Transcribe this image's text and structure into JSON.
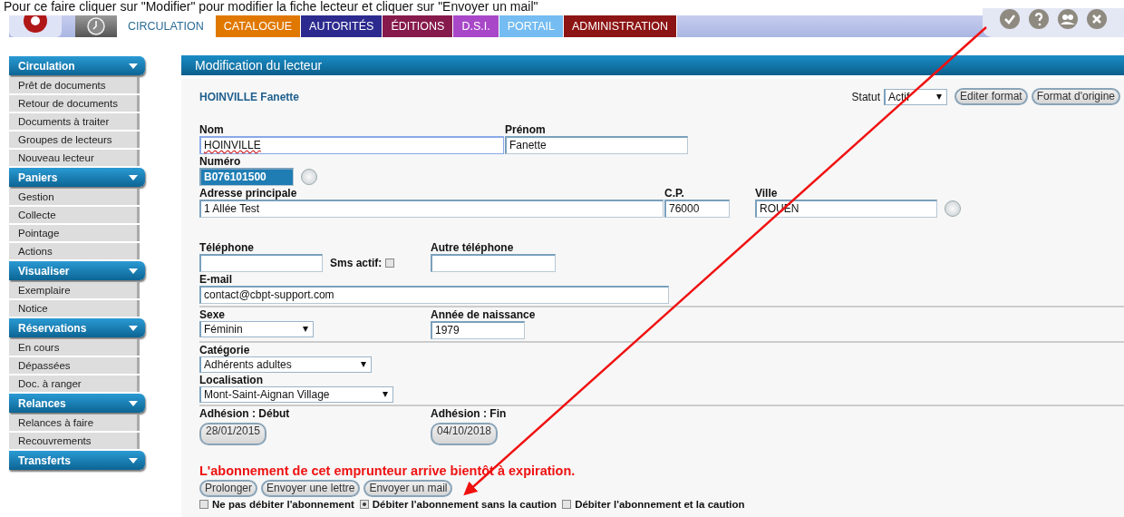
{
  "instruction": "Pour ce faire cliquer sur \"Modifier\" pour modifier la fiche lecteur et cliquer sur \"Envoyer un mail\"",
  "top_tabs": [
    {
      "label": "CIRCULATION",
      "selected": true,
      "color": "#ffffff"
    },
    {
      "label": "CATALOGUE",
      "selected": false,
      "color": "#e07800"
    },
    {
      "label": "AUTORITÉS",
      "selected": false,
      "color": "#2c2a8e"
    },
    {
      "label": "ÉDITIONS",
      "selected": false,
      "color": "#861a4c"
    },
    {
      "label": "D.S.I.",
      "selected": false,
      "color": "#a848c8"
    },
    {
      "label": "PORTAIL",
      "selected": false,
      "color": "#74bcf2"
    },
    {
      "label": "ADMINISTRATION",
      "selected": false,
      "color": "#8c1414"
    }
  ],
  "sidebar": [
    {
      "title": "Circulation",
      "items": [
        "Prêt de documents",
        "Retour de documents",
        "Documents à traiter",
        "Groupes de lecteurs",
        "Nouveau lecteur"
      ]
    },
    {
      "title": "Paniers",
      "items": [
        "Gestion",
        "Collecte",
        "Pointage",
        "Actions"
      ]
    },
    {
      "title": "Visualiser",
      "items": [
        "Exemplaire",
        "Notice"
      ]
    },
    {
      "title": "Réservations",
      "items": [
        "En cours",
        "Dépassées",
        "Doc. à ranger"
      ]
    },
    {
      "title": "Relances",
      "items": [
        "Relances à faire",
        "Recouvrements"
      ]
    },
    {
      "title": "Transferts"
    }
  ],
  "panel_title": "Modification du lecteur",
  "reader_name": "HOINVILLE Fanette",
  "statut": {
    "label": "Statut",
    "value": "Actif"
  },
  "format_buttons": [
    "Editer format",
    "Format d'origine"
  ],
  "form": {
    "nom": {
      "label": "Nom",
      "value": "HOINVILLE"
    },
    "prenom": {
      "label": "Prénom",
      "value": "Fanette"
    },
    "numero": {
      "label": "Numéro",
      "value": "B076101500"
    },
    "adresse": {
      "label": "Adresse principale",
      "value": "1 Allée Test"
    },
    "cp": {
      "label": "C.P.",
      "value": "76000"
    },
    "ville": {
      "label": "Ville",
      "value": "ROUEN"
    },
    "telephone": {
      "label": "Téléphone"
    },
    "sms": {
      "label": "Sms actif:",
      "checked": false
    },
    "autre_telephone": {
      "label": "Autre téléphone"
    },
    "email": {
      "label": "E-mail",
      "value": "contact@cbpt-support.com"
    },
    "sexe": {
      "label": "Sexe",
      "value": "Féminin"
    },
    "annee": {
      "label": "Année de naissance",
      "value": "1979"
    },
    "categorie": {
      "label": "Catégorie",
      "value": "Adhérents adultes"
    },
    "localisation": {
      "label": "Localisation",
      "value": "Mont-Saint-Aignan Village"
    },
    "adhesion_debut": {
      "label": "Adhésion : Début",
      "value": "28/01/2015"
    },
    "adhesion_fin": {
      "label": "Adhésion : Fin",
      "value": "04/10/2018"
    }
  },
  "warning": "L'abonnement de cet emprunteur arrive bientôt à expiration.",
  "actions": [
    "Prolonger",
    "Envoyer une lettre",
    "Envoyer un mail"
  ],
  "debit_options": [
    {
      "label": "Ne pas débiter l'abonnement",
      "selected": false
    },
    {
      "label": "Débiter l'abonnement sans la caution",
      "selected": true
    },
    {
      "label": "Débiter l'abonnement et la caution",
      "selected": false
    }
  ]
}
